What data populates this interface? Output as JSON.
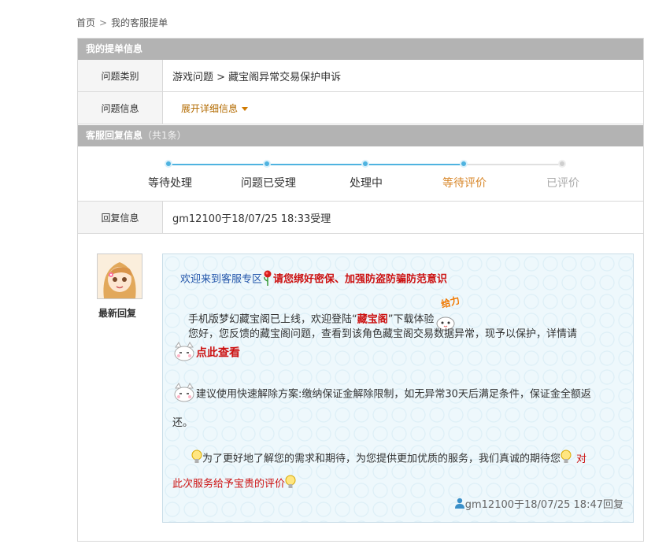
{
  "breadcrumb": {
    "home": "首页",
    "separator": ">",
    "current": "我的客服提单"
  },
  "ticket_section": {
    "title": "我的提单信息"
  },
  "rows": {
    "category_label": "问题类别",
    "category_value": "游戏问题 > 藏宝阁异常交易保护申诉",
    "info_label": "问题信息",
    "expand_label": "展开详细信息"
  },
  "reply_section": {
    "title": "客服回复信息",
    "count": "（共1条）"
  },
  "progress": {
    "steps": [
      {
        "label": "等待处理",
        "state": "done"
      },
      {
        "label": "问题已受理",
        "state": "done"
      },
      {
        "label": "处理中",
        "state": "done"
      },
      {
        "label": "等待评价",
        "state": "current"
      },
      {
        "label": "已评价",
        "state": "todo"
      }
    ]
  },
  "reply_info": {
    "label": "回复信息",
    "value": "gm12100于18/07/25 18:33受理"
  },
  "message": {
    "latest_label": "最新回复",
    "welcome": "欢迎来到客服专区",
    "security_tip": "请您绑好密保、加强防盗防骗防范意识",
    "mobile_pre": "手机版梦幻藏宝阁已上线，欢迎登陆“",
    "mobile_link": "藏宝阁",
    "mobile_post": "”下载体验",
    "result_line": "您好，您反馈的藏宝阁问题，查看到该角色藏宝阁交易数据异常，现予以保护，详情请",
    "click_here": "点此查看",
    "suggest_line1": "建议使用快速解除方案:缴纳保证金解除限制，如无异常30天后满足条件，保证金全额返",
    "suggest_line2": "还。",
    "service_line": "为了更好地了解您的需求和期待，为您提供更加优质的服务，我们真诚的期待您",
    "rate_link_1": "对",
    "rate_link_2": "此次服务给予宝贵的评价",
    "footer": "gm12100于18/07/25 18:47回复",
    "sticker_text": "给力"
  },
  "colors": {
    "accent_blue": "#4fb3e0",
    "header_gray": "#b3b3b3",
    "highlight_red": "#cc1111",
    "current_orange": "#d8872a"
  }
}
